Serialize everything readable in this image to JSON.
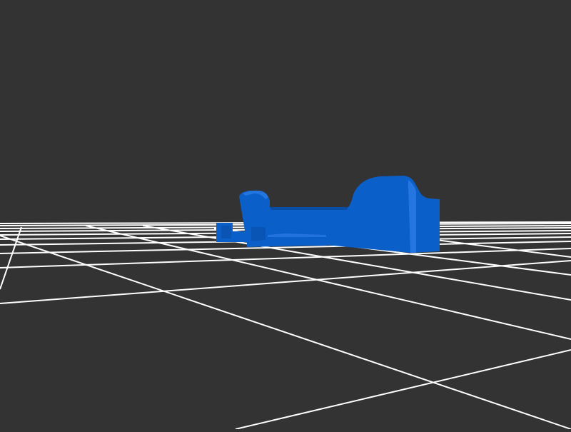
{
  "scene": {
    "background_color": "#333333",
    "grid_color": "#ffffff",
    "model_color": "#0b5fc8",
    "model_highlight_color": "#2b7ae6",
    "model_shadow_color": "#0a4da6"
  }
}
